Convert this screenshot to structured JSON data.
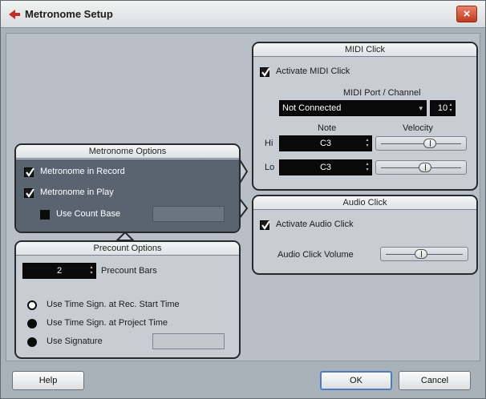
{
  "window": {
    "title": "Metronome Setup",
    "close_glyph": "×"
  },
  "midi_click": {
    "header": "MIDI Click",
    "activate_label": "Activate MIDI Click",
    "activate_checked": true,
    "port_channel_label": "MIDI Port / Channel",
    "port_value": "Not Connected",
    "channel_value": "10",
    "note_header": "Note",
    "velocity_header": "Velocity",
    "hi_label": "Hi",
    "hi_note": "C3",
    "hi_velocity_fraction": 0.62,
    "lo_label": "Lo",
    "lo_note": "C3",
    "lo_velocity_fraction": 0.55
  },
  "metronome_options": {
    "header": "Metronome Options",
    "in_record_label": "Metronome in Record",
    "in_record_checked": true,
    "in_play_label": "Metronome in Play",
    "in_play_checked": true,
    "count_base_label": "Use Count Base",
    "count_base_checked": false
  },
  "audio_click": {
    "header": "Audio Click",
    "activate_label": "Activate Audio Click",
    "activate_checked": true,
    "volume_label": "Audio Click Volume",
    "volume_fraction": 0.45
  },
  "precount_options": {
    "header": "Precount Options",
    "bars_value": "2",
    "bars_label": "Precount Bars",
    "radio_options": [
      {
        "label": "Use Time Sign. at Rec. Start Time",
        "selected": true
      },
      {
        "label": "Use Time Sign. at Project Time",
        "selected": false
      },
      {
        "label": "Use Signature",
        "selected": false
      }
    ]
  },
  "buttons": {
    "help": "Help",
    "ok": "OK",
    "cancel": "Cancel"
  },
  "colors": {
    "accent": "#4f7bc4",
    "close": "#c1391d"
  }
}
